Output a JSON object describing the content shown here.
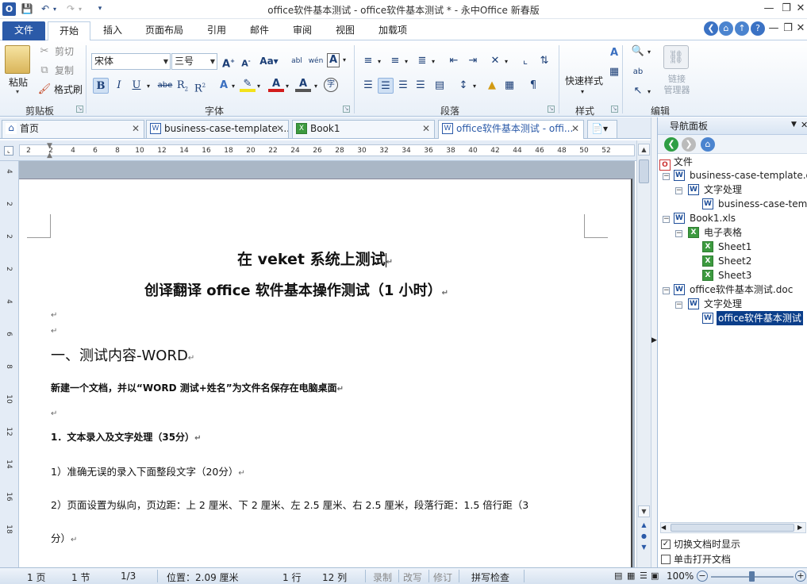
{
  "window": {
    "title": "office软件基本测试 - office软件基本测试 *  - 永中Office 新春版",
    "app_icon": "O"
  },
  "ribbon_tabs": [
    "文件",
    "开始",
    "插入",
    "页面布局",
    "引用",
    "邮件",
    "审阅",
    "视图",
    "加载项"
  ],
  "clipboard": {
    "paste": "粘贴",
    "cut": "剪切",
    "copy": "复制",
    "format_painter": "格式刷",
    "group": "剪贴板"
  },
  "font": {
    "name": "宋体",
    "size": "三号",
    "group": "字体"
  },
  "paragraph": {
    "group": "段落"
  },
  "styles": {
    "quick": "快速样式",
    "group": "样式"
  },
  "editing": {
    "group": "编辑",
    "link_manager_1": "链接",
    "link_manager_2": "管理器"
  },
  "doc_tabs": [
    {
      "label": "首页"
    },
    {
      "label": "business-case-template ..."
    },
    {
      "label": "Book1"
    },
    {
      "label": "office软件基本测试 - offi..."
    }
  ],
  "ruler": {
    "h": [
      "2",
      "2",
      "4",
      "6",
      "8",
      "10",
      "12",
      "14",
      "16",
      "18",
      "20",
      "22",
      "24",
      "26",
      "28",
      "30",
      "32",
      "34",
      "36",
      "38",
      "40",
      "42",
      "44",
      "46",
      "48",
      "50",
      "52"
    ],
    "v": [
      "4",
      "2",
      "2",
      "2",
      "4",
      "6",
      "8",
      "10",
      "12",
      "14",
      "16",
      "18"
    ]
  },
  "document": {
    "title1_a": "在",
    "title1_b": " veket ",
    "title1_c": "系统上测试",
    "title2_a": "创译翻译 ",
    "title2_b": "office",
    "title2_c": " 软件基本操作测试（1 小时）",
    "heading": "一、测试内容-WORD",
    "line_new": "新建一个文档，并以“WORD 测试+姓名”为文件名保存在电脑桌面",
    "sec1": "1．文本录入及文字处理（35分）",
    "item1": "1）准确无误的录入下面整段文字（20分）",
    "item2": "2）页面设置为纵向，页边距：上 2 厘米、下 2 厘米、左 2.5 厘米、右 2.5 厘米，段落行距：1.5 倍行距（3",
    "item2b": "分）",
    "para_mark": "↵"
  },
  "nav": {
    "title": "导航面板",
    "root": "文件",
    "doc1": "business-case-template.doc",
    "doc1_cat": "文字处理",
    "doc1_leaf": "business-case-templa",
    "xls": "Book1.xls",
    "xls_cat": "电子表格",
    "sheets": [
      "Sheet1",
      "Sheet2",
      "Sheet3"
    ],
    "doc2": "office软件基本测试.doc",
    "doc2_cat": "文字处理",
    "doc2_leaf": "office软件基本测试",
    "opt_switch": "切换文档时显示",
    "opt_single": "单击打开文档",
    "opt_switch_checked": true,
    "opt_single_checked": false
  },
  "status": {
    "page": "1 页",
    "section": "1 节",
    "pages": "1/3",
    "position": "位置：2.09 厘米",
    "row": "1 行",
    "col": "12 列",
    "record": "录制",
    "revise": "改写",
    "revision": "修订",
    "spell": "拼写检查",
    "zoom": "100%"
  }
}
